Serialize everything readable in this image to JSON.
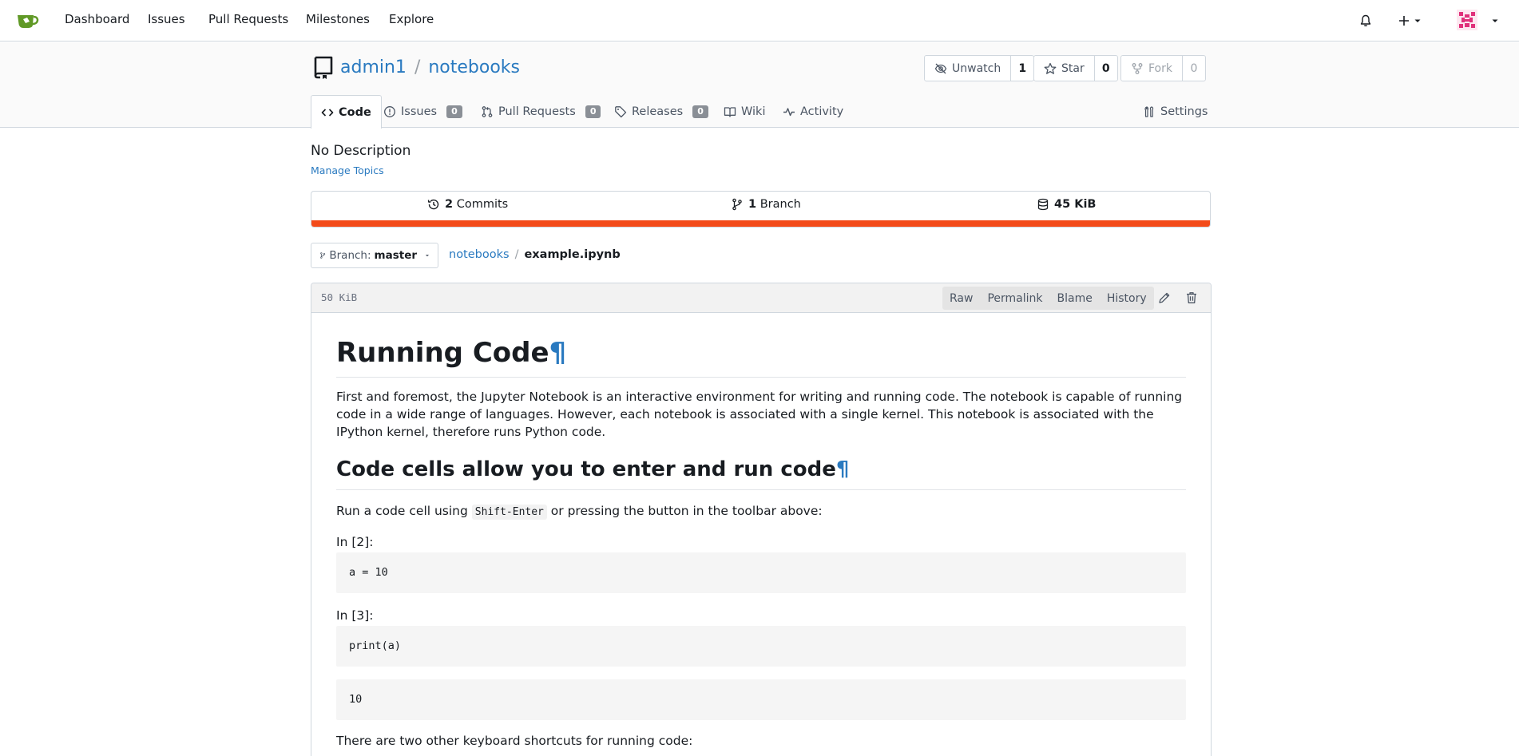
{
  "navbar": {
    "links": [
      "Dashboard",
      "Issues",
      "Pull Requests",
      "Milestones",
      "Explore"
    ],
    "brand_color": "#609926"
  },
  "repo": {
    "owner": "admin1",
    "name": "notebooks",
    "separator": "/",
    "watch": {
      "label": "Unwatch",
      "count": "1"
    },
    "star": {
      "label": "Star",
      "count": "0"
    },
    "fork": {
      "label": "Fork",
      "count": "0"
    }
  },
  "tabs": [
    {
      "label": "Code",
      "badge": null
    },
    {
      "label": "Issues",
      "badge": "0"
    },
    {
      "label": "Pull Requests",
      "badge": "0"
    },
    {
      "label": "Releases",
      "badge": "0"
    },
    {
      "label": "Wiki",
      "badge": null
    },
    {
      "label": "Activity",
      "badge": null
    }
  ],
  "settings_tab": "Settings",
  "description": "No Description",
  "manage_topics": "Manage Topics",
  "stats": {
    "commits_count": "2",
    "commits_label": "Commits",
    "branch_count": "1",
    "branch_label": "Branch",
    "size": "45 KiB",
    "lang_color": "#f34b1a"
  },
  "branch": {
    "prefix": "Branch:",
    "name": "master"
  },
  "breadcrumb": {
    "repo": "notebooks",
    "sep": "/",
    "file": "example.ipynb"
  },
  "file": {
    "size": "50 KiB",
    "actions": [
      "Raw",
      "Permalink",
      "Blame",
      "History"
    ]
  },
  "notebook": {
    "h1": "Running Code",
    "pilcrow": "¶",
    "intro": "First and foremost, the Jupyter Notebook is an interactive environment for writing and running code. The notebook is capable of running code in a wide range of languages. However, each notebook is associated with a single kernel. This notebook is associated with the IPython kernel, therefore runs Python code.",
    "h2": "Code cells allow you to enter and run code",
    "run_text_before": "Run a code cell using ",
    "run_code": "Shift-Enter",
    "run_text_after": " or pressing the button in the toolbar above:",
    "prompt1": "In [2]:",
    "cell1": "a = 10",
    "prompt2": "In [3]:",
    "cell2": "print(a)",
    "output2": "10",
    "shortcuts_text": "There are two other keyboard shortcuts for running code:"
  }
}
